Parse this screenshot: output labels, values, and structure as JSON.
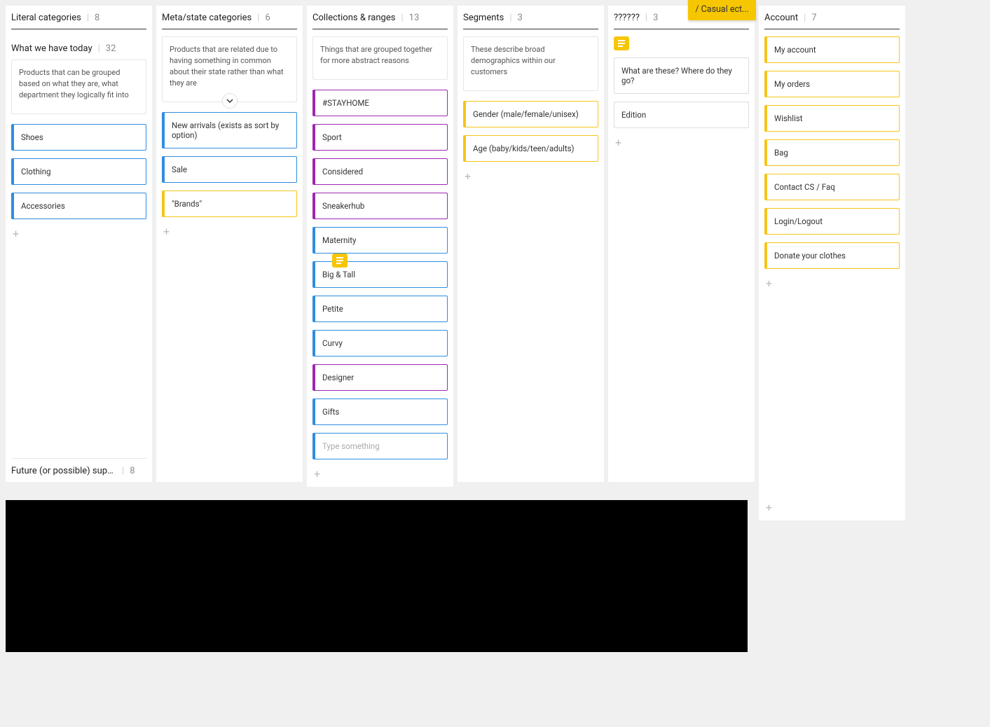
{
  "sticky": "/ Casual ect...",
  "subheader": {
    "title": "What we have today",
    "count": 32
  },
  "columns": [
    {
      "title": "Literal categories",
      "count": 8,
      "desc": "Products that can be grouped based on what they are, what department they logically fit into",
      "cards": [
        {
          "label": "Shoes",
          "color": "blue"
        },
        {
          "label": "Clothing",
          "color": "blue"
        },
        {
          "label": "Accessories",
          "color": "blue"
        }
      ],
      "footer": {
        "title": "Future (or possible) supp...",
        "count": 8
      }
    },
    {
      "title": "Meta/state categories",
      "count": 6,
      "desc": "Products that are related due to having something in common about their state rather than what they are",
      "desc_expandable": true,
      "cards": [
        {
          "label": "New arrivals (exists as sort by option)",
          "color": "blue"
        },
        {
          "label": "Sale",
          "color": "blue"
        },
        {
          "label": "\"Brands\"",
          "color": "yellow"
        }
      ]
    },
    {
      "title": "Collections & ranges",
      "count": 13,
      "desc": "Things that are grouped together for more abstract reasons",
      "cards": [
        {
          "label": "#STAYHOME",
          "color": "purple"
        },
        {
          "label": "Sport",
          "color": "purple"
        },
        {
          "label": "Considered",
          "color": "purple"
        },
        {
          "label": "Sneakerhub",
          "color": "purple"
        },
        {
          "label": "Maternity",
          "color": "blue"
        },
        {
          "label": "Big & Tall",
          "color": "blue",
          "has_comment": true
        },
        {
          "label": "Petite",
          "color": "blue"
        },
        {
          "label": "Curvy",
          "color": "blue"
        },
        {
          "label": "Designer",
          "color": "purple"
        },
        {
          "label": "Gifts",
          "color": "blue"
        }
      ],
      "input_placeholder": "Type something"
    },
    {
      "title": "Segments",
      "count": 3,
      "desc": "These describe broad demographics within our customers",
      "cards": [
        {
          "label": "Gender (male/female/unisex)",
          "color": "yellow"
        },
        {
          "label": "Age (baby/kids/teen/adults)",
          "color": "yellow"
        }
      ]
    },
    {
      "title": "??????",
      "count": 3,
      "has_header_comment": true,
      "cards": [
        {
          "label": "What are these? Where do they go?",
          "color": "gray"
        },
        {
          "label": "Edition",
          "color": "gray"
        }
      ]
    },
    {
      "title": "Account",
      "count": 7,
      "cards": [
        {
          "label": "My account",
          "color": "yellow"
        },
        {
          "label": "My orders",
          "color": "yellow"
        },
        {
          "label": "Wishlist",
          "color": "yellow"
        },
        {
          "label": "Bag",
          "color": "yellow"
        },
        {
          "label": "Contact CS / Faq",
          "color": "yellow"
        },
        {
          "label": "Login/Logout",
          "color": "yellow"
        },
        {
          "label": "Donate your clothes",
          "color": "yellow"
        }
      ],
      "second_add": true
    }
  ]
}
